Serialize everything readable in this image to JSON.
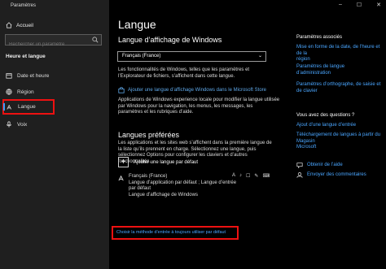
{
  "window": {
    "title": "Paramètres",
    "controls": [
      "–",
      "☐",
      "✕"
    ]
  },
  "sidebar": {
    "home": "Accueil",
    "search_placeholder": "Rechercher un paramètre",
    "section_title": "Heure et langue",
    "items": [
      {
        "label": "Date et heure",
        "icon": "calendar-icon"
      },
      {
        "label": "Région",
        "icon": "globe-icon"
      },
      {
        "label": "Langue",
        "icon": "language-icon",
        "active": true
      },
      {
        "label": "Voix",
        "icon": "microphone-icon"
      }
    ]
  },
  "main": {
    "title": "Langue",
    "display_language": {
      "heading": "Langue d’affichage de Windows",
      "selected": "Français (France)",
      "desc": [
        "Les fonctionnalités de Windows, telles que les paramètres et",
        "l’Explorateur de fichiers, s’affichent dans cette langue."
      ],
      "store_link": "Ajouter une langue d’affichage Windows dans le Microsoft Store",
      "experience_desc": [
        "Applications de Windows experience locale pour modifier la langue utilisée",
        "par Windows pour la navigation, les menus, les messages, les",
        "paramètres et les rubriques d’aide."
      ]
    },
    "preferred": {
      "heading": "Langues préférées",
      "desc": [
        "Les applications et les sites web s’affichent dans la première langue de",
        "la liste qu’ils prennent en charge. Sélectionnez une langue, puis",
        "sélectionnez Options pour configurer les claviers et d’autres",
        "fonctionnalités."
      ],
      "add_label": "Ajouter une langue par défaut",
      "language": {
        "name": "Français (France)",
        "line2": "Langue d’application par défaut ; Langue d’entrée par défaut",
        "line3": "Langue d’affichage de Windows"
      },
      "default_input_link": "Choisir la méthode d’entrée à toujours utiliser par défaut"
    }
  },
  "right": {
    "related_title": "Paramètres associés",
    "related_links": [
      [
        "Mise en forme de la date, de l’heure et de la",
        "région"
      ],
      [
        "Paramètres de langue",
        "d’administration"
      ],
      [
        "Paramètres d’orthographe, de saisie et",
        "de clavier"
      ]
    ],
    "questions_title": "Vous avez des questions ?",
    "question_links": [
      [
        "Ajout d’une langue d’entrée"
      ],
      [
        "Téléchargement de langues à partir du Magasin",
        "Microsoft"
      ]
    ],
    "help": "Obtenir de l’aide",
    "feedback": "Envoyer des commentaires"
  }
}
